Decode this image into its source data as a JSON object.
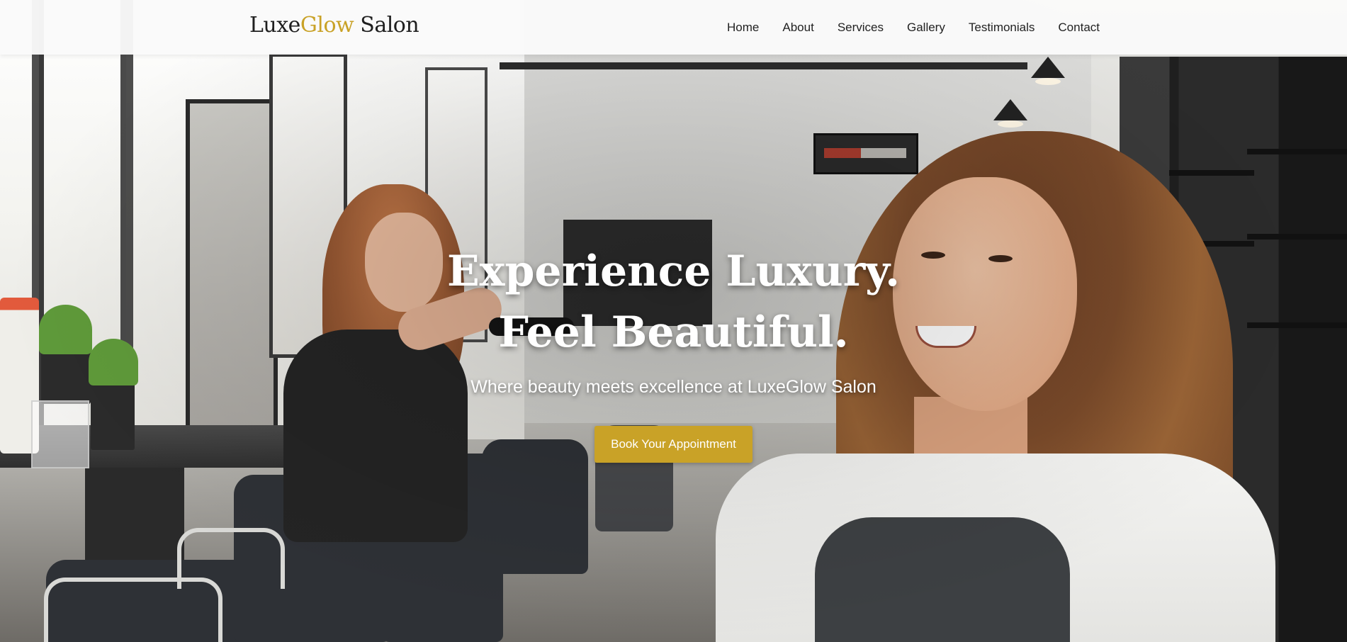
{
  "brand": {
    "name_part1": "Luxe",
    "name_accent": "Glow",
    "name_part2": " Salon",
    "accent_color": "#c9a227"
  },
  "nav": {
    "items": [
      {
        "label": "Home"
      },
      {
        "label": "About"
      },
      {
        "label": "Services"
      },
      {
        "label": "Gallery"
      },
      {
        "label": "Testimonials"
      },
      {
        "label": "Contact"
      }
    ]
  },
  "hero": {
    "title": "Experience Luxury. Feel Beautiful.",
    "subtitle": "Where beauty meets excellence at LuxeGlow Salon",
    "cta_label": "Book Your Appointment",
    "cta_color": "#c9a227"
  }
}
